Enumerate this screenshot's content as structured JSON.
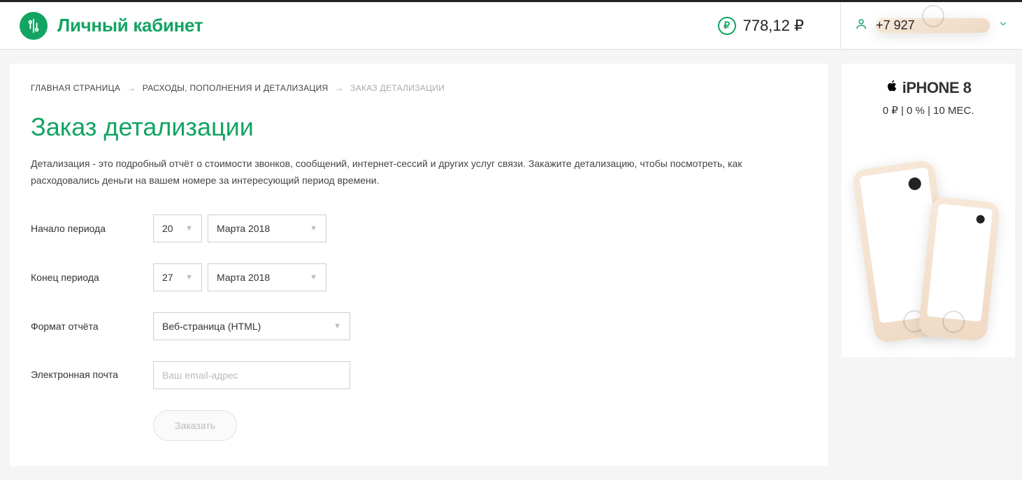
{
  "header": {
    "brand": "Личный кабинет",
    "balance": "778,12 ₽",
    "phone": "+7 927"
  },
  "breadcrumb": {
    "home": "ГЛАВНАЯ СТРАНИЦА",
    "section": "РАСХОДЫ, ПОПОЛНЕНИЯ И ДЕТАЛИЗАЦИЯ",
    "current": "ЗАКАЗ ДЕТАЛИЗАЦИИ"
  },
  "page": {
    "title": "Заказ детализации",
    "description": "Детализация - это подробный отчёт о стоимости звонков, сообщений, интернет-сессий и других услуг связи. Закажите детализацию, чтобы посмотреть, как расходовались деньги на вашем номере за интересующий период времени."
  },
  "form": {
    "start_label": "Начало периода",
    "start_day": "20",
    "start_month": "Марта 2018",
    "end_label": "Конец периода",
    "end_day": "27",
    "end_month": "Марта 2018",
    "format_label": "Формат отчёта",
    "format_value": "Веб-страница (HTML)",
    "email_label": "Электронная почта",
    "email_placeholder": "Ваш email-адрес",
    "submit": "Заказать"
  },
  "ad": {
    "title": "iPHONE 8",
    "price": "0 ₽ | 0 % | 10 МЕС."
  }
}
